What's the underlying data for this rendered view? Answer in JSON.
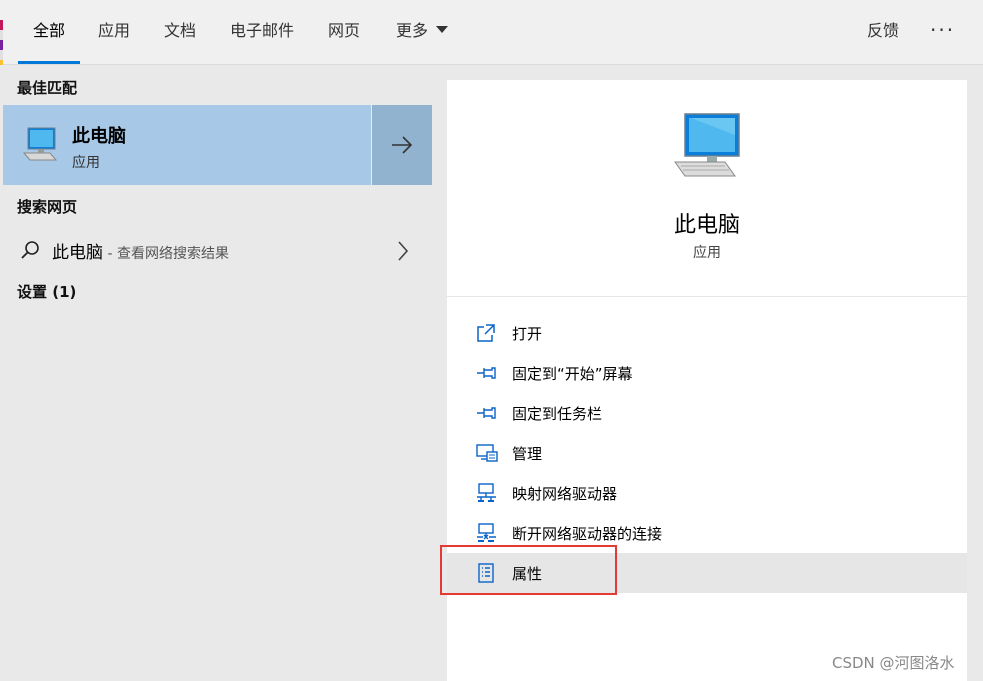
{
  "tabs": [
    {
      "label": "全部",
      "active": true
    },
    {
      "label": "应用"
    },
    {
      "label": "文档"
    },
    {
      "label": "电子邮件"
    },
    {
      "label": "网页"
    },
    {
      "label": "更多"
    }
  ],
  "feedback_label": "反馈",
  "more_options_label": "···",
  "left": {
    "best_match_header": "最佳匹配",
    "best_match": {
      "title": "此电脑",
      "subtitle": "应用",
      "icon": "computer-icon"
    },
    "web_search_header": "搜索网页",
    "web_search": {
      "query": "此电脑",
      "suffix": " - 查看网络搜索结果"
    },
    "settings_header": "设置 (1)"
  },
  "right": {
    "title": "此电脑",
    "subtitle": "应用",
    "actions": [
      {
        "label": "打开",
        "icon": "open-icon"
      },
      {
        "label": "固定到“开始”屏幕",
        "icon": "pin-icon"
      },
      {
        "label": "固定到任务栏",
        "icon": "pin-icon"
      },
      {
        "label": "管理",
        "icon": "manage-icon"
      },
      {
        "label": "映射网络驱动器",
        "icon": "network-drive-icon"
      },
      {
        "label": "断开网络驱动器的连接",
        "icon": "disconnect-drive-icon"
      },
      {
        "label": "属性",
        "icon": "properties-icon",
        "highlighted": true
      }
    ]
  },
  "watermark": "CSDN @河图洛水",
  "colors": {
    "accent": "#0078d7",
    "selected_bg": "#a7c8e6",
    "highlight_box": "#e53935"
  }
}
